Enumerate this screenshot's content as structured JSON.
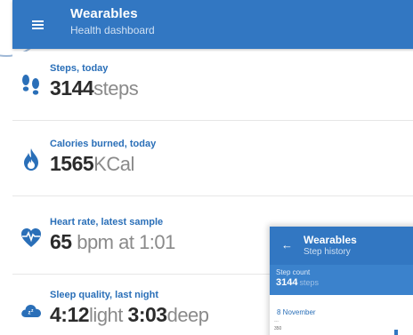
{
  "header": {
    "title": "Wearables",
    "subtitle": "Health dashboard"
  },
  "cards": [
    {
      "label": "Steps, today",
      "value": "3144",
      "unit": "steps",
      "icon": "footprints-icon"
    },
    {
      "label": "Calories burned, today",
      "value": "1565",
      "unit": "KCal",
      "icon": "flame-icon"
    },
    {
      "label": "Heart rate, latest sample",
      "value": "65",
      "unit": " bpm at 1:01",
      "icon": "heart-pulse-icon"
    },
    {
      "label": "Sleep quality, last night",
      "value_light": "4:12",
      "unit_light": "light ",
      "value_deep": "3:03",
      "unit_deep": "deep",
      "icon": "sleep-cloud-icon"
    }
  ],
  "step_history": {
    "title": "Wearables",
    "subtitle": "Step history",
    "count_label": "Step count",
    "count_value": "3144",
    "count_unit": "steps",
    "date": "8 November",
    "axis_tick": "350"
  },
  "colors": {
    "primary": "#3277c2",
    "accent_label": "#2a6fb8"
  }
}
